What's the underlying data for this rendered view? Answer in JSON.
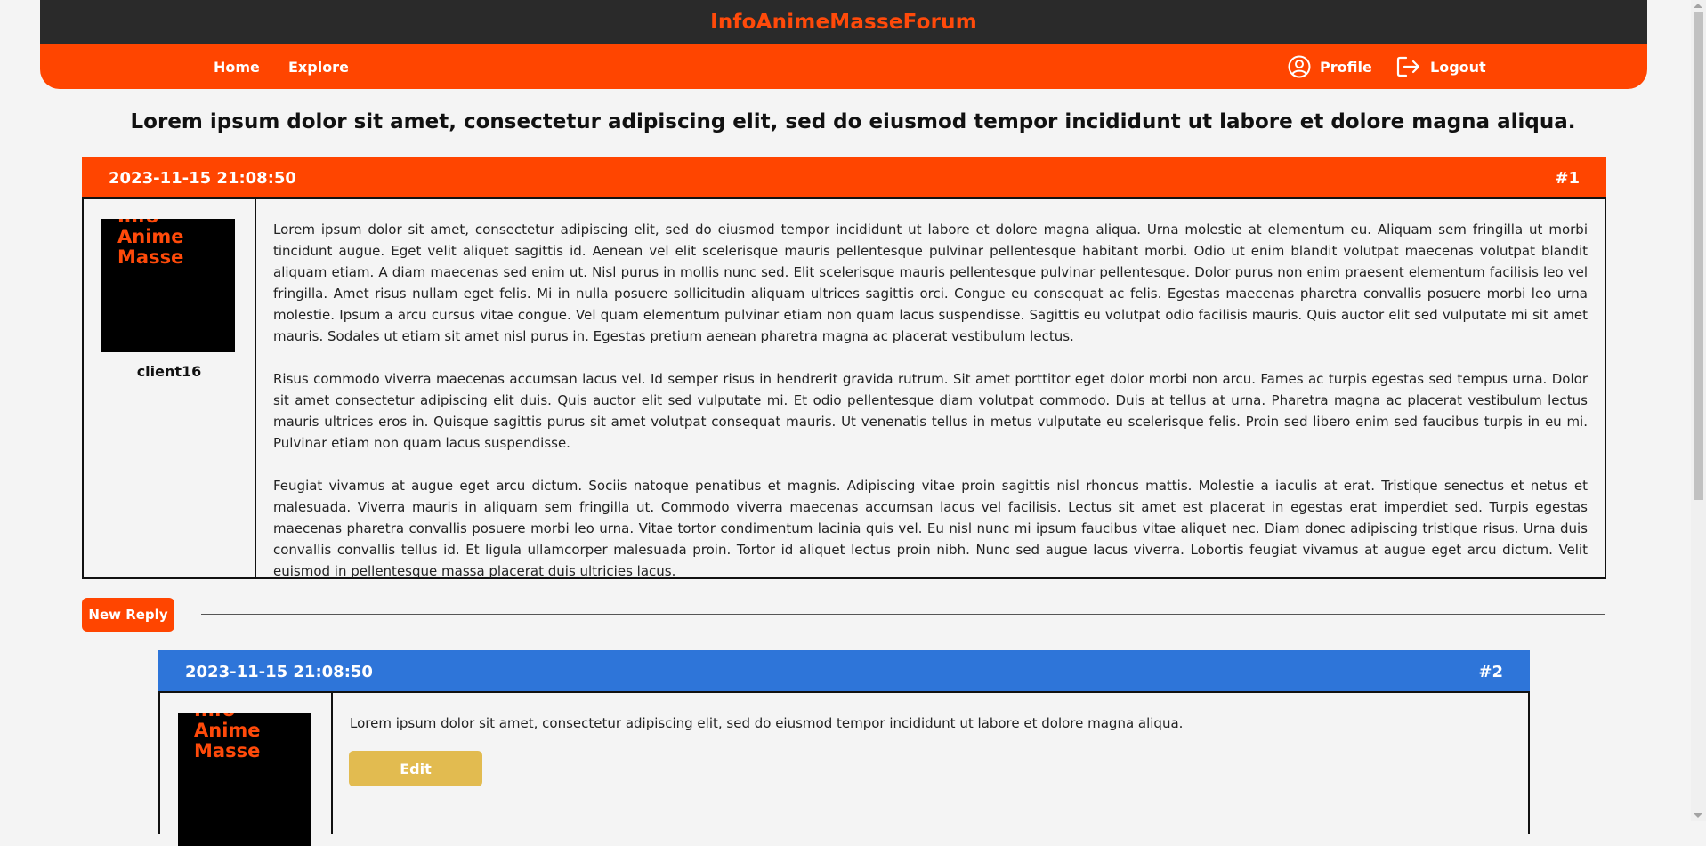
{
  "header": {
    "brand": "InfoAnimeMasseForum",
    "nav": {
      "home": "Home",
      "explore": "Explore",
      "profile": "Profile",
      "logout": "Logout"
    },
    "colors": {
      "top_bar": "#2a2a2a",
      "nav_bar": "#ff4500",
      "brand": "#ff4a0a"
    }
  },
  "thread": {
    "title": "Lorem ipsum dolor sit amet, consectetur adipiscing elit, sed do eiusmod tempor incididunt ut labore et dolore magna aliqua."
  },
  "posts": [
    {
      "timestamp": "2023-11-15 21:08:50",
      "number": "#1",
      "header_color": "#ff4500",
      "avatar_logo": "Info Anime Masse",
      "username": "client16",
      "paragraphs": [
        "Lorem ipsum dolor sit amet, consectetur adipiscing elit, sed do eiusmod tempor incididunt ut labore et dolore magna aliqua. Urna molestie at elementum eu. Aliquam sem fringilla ut morbi tincidunt augue. Eget velit aliquet sagittis id. Aenean vel elit scelerisque mauris pellentesque pulvinar pellentesque habitant morbi. Odio ut enim blandit volutpat maecenas volutpat blandit aliquam etiam. A diam maecenas sed enim ut. Nisl purus in mollis nunc sed. Elit scelerisque mauris pellentesque pulvinar pellentesque. Dolor purus non enim praesent elementum facilisis leo vel fringilla. Amet risus nullam eget felis. Mi in nulla posuere sollicitudin aliquam ultrices sagittis orci. Congue eu consequat ac felis. Egestas maecenas pharetra convallis posuere morbi leo urna molestie. Ipsum a arcu cursus vitae congue. Vel quam elementum pulvinar etiam non quam lacus suspendisse. Sagittis eu volutpat odio facilisis mauris. Quis auctor elit sed vulputate mi sit amet mauris. Sodales ut etiam sit amet nisl purus in. Egestas pretium aenean pharetra magna ac placerat vestibulum lectus.",
        "Risus commodo viverra maecenas accumsan lacus vel. Id semper risus in hendrerit gravida rutrum. Sit amet porttitor eget dolor morbi non arcu. Fames ac turpis egestas sed tempus urna. Dolor sit amet consectetur adipiscing elit duis. Quis auctor elit sed vulputate mi. Et odio pellentesque diam volutpat commodo. Duis at tellus at urna. Pharetra magna ac placerat vestibulum lectus mauris ultrices eros in. Quisque sagittis purus sit amet volutpat consequat mauris. Ut venenatis tellus in metus vulputate eu scelerisque felis. Proin sed libero enim sed faucibus turpis in eu mi. Pulvinar etiam non quam lacus suspendisse.",
        "Feugiat vivamus at augue eget arcu dictum. Sociis natoque penatibus et magnis. Adipiscing vitae proin sagittis nisl rhoncus mattis. Molestie a iaculis at erat. Tristique senectus et netus et malesuada. Viverra mauris in aliquam sem fringilla ut. Commodo viverra maecenas accumsan lacus vel facilisis. Lectus sit amet est placerat in egestas erat imperdiet sed. Turpis egestas maecenas pharetra convallis posuere morbi leo urna. Vitae tortor condimentum lacinia quis vel. Eu nisl nunc mi ipsum faucibus vitae aliquet nec. Diam donec adipiscing tristique risus. Urna duis convallis convallis tellus id. Et ligula ullamcorper malesuada proin. Tortor id aliquet lectus proin nibh. Nunc sed augue lacus viverra. Lobortis feugiat vivamus at augue eget arcu dictum. Velit euismod in pellentesque massa placerat duis ultricies lacus."
      ]
    },
    {
      "timestamp": "2023-11-15 21:08:50",
      "number": "#2",
      "header_color": "#2e75d9",
      "avatar_logo": "Info Anime Masse",
      "paragraphs": [
        "Lorem ipsum dolor sit amet, consectetur adipiscing elit, sed do eiusmod tempor incididunt ut labore et dolore magna aliqua."
      ],
      "edit_label": "Edit"
    }
  ],
  "actions": {
    "new_reply": "New Reply",
    "new_reply_color": "#ff4500",
    "edit_color": "#e2bb50"
  }
}
